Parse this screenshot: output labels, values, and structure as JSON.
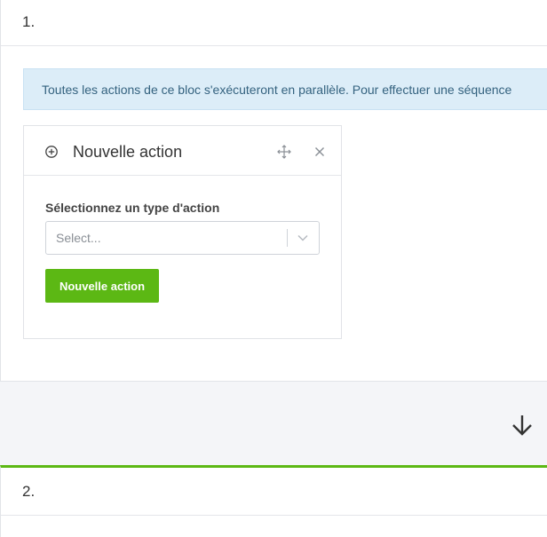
{
  "blocks": [
    {
      "number": "1.",
      "info": "Toutes les actions de ce bloc s'exécuteront en parallèle. Pour effectuer une séquence",
      "action_card": {
        "title": "Nouvelle action",
        "icon": "plus-circle-icon",
        "field_label": "Sélectionnez un type d'action",
        "select_placeholder": "Select...",
        "button_label": "Nouvelle action"
      }
    },
    {
      "number": "2."
    }
  ],
  "connector": {
    "icon": "arrow-down-icon"
  },
  "colors": {
    "accent": "#5cb814",
    "info_background": "#dcedf8",
    "info_text": "#34627f",
    "page_background": "#f4f5f8"
  }
}
